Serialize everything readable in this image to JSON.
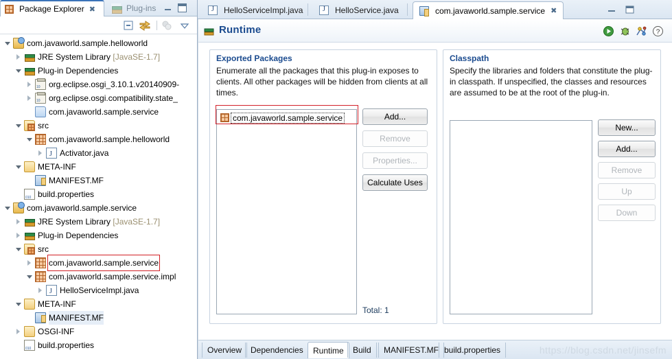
{
  "left_view": {
    "tabs": [
      {
        "label": "Package Explorer",
        "icon": "package-explorer-icon",
        "active": true,
        "closeable": true
      },
      {
        "label": "Plug-ins",
        "icon": "plugins-icon",
        "active": false,
        "closeable": false
      }
    ],
    "window_buttons": [
      "minimize-icon",
      "maximize-icon"
    ],
    "toolbar_icons": [
      "collapse-all-icon",
      "link-with-editor-icon",
      "focus-on-active-task-icon",
      "view-menu-icon"
    ],
    "tree": [
      {
        "label": "com.javaworld.sample.helloworld",
        "icon": "plugin-project-icon",
        "indent": 0,
        "twisty": "expanded"
      },
      {
        "label": "JRE System Library",
        "suffix": " [JavaSE-1.7]",
        "icon": "library-icon",
        "indent": 1,
        "twisty": "collapsed"
      },
      {
        "label": "Plug-in Dependencies",
        "icon": "library-icon",
        "indent": 1,
        "twisty": "expanded"
      },
      {
        "label": "org.eclipse.osgi_3.10.1.v20140909-",
        "icon": "jar-icon",
        "indent": 2,
        "twisty": "collapsed"
      },
      {
        "label": "org.eclipse.osgi.compatibility.state_",
        "icon": "jar-icon",
        "indent": 2,
        "twisty": "collapsed"
      },
      {
        "label": "com.javaworld.sample.service",
        "icon": "folder-blue-icon",
        "indent": 2,
        "twisty": "none"
      },
      {
        "label": "src",
        "icon": "source-folder-icon",
        "indent": 1,
        "twisty": "expanded"
      },
      {
        "label": "com.javaworld.sample.helloworld",
        "icon": "package-icon",
        "indent": 2,
        "twisty": "expanded"
      },
      {
        "label": "Activator.java",
        "icon": "java-file-icon",
        "indent": 3,
        "twisty": "collapsed"
      },
      {
        "label": "META-INF",
        "icon": "folder-icon",
        "indent": 1,
        "twisty": "expanded"
      },
      {
        "label": "MANIFEST.MF",
        "icon": "manifest-icon",
        "indent": 2,
        "twisty": "none"
      },
      {
        "label": "build.properties",
        "icon": "properties-file-icon",
        "indent": 1,
        "twisty": "none"
      },
      {
        "label": "com.javaworld.sample.service",
        "icon": "plugin-project-icon",
        "indent": 0,
        "twisty": "expanded"
      },
      {
        "label": "JRE System Library",
        "suffix": " [JavaSE-1.7]",
        "icon": "library-icon",
        "indent": 1,
        "twisty": "collapsed"
      },
      {
        "label": "Plug-in Dependencies",
        "icon": "library-icon",
        "indent": 1,
        "twisty": "collapsed"
      },
      {
        "label": "src",
        "icon": "source-folder-icon",
        "indent": 1,
        "twisty": "expanded"
      },
      {
        "label": "com.javaworld.sample.service",
        "icon": "package-icon",
        "indent": 2,
        "twisty": "collapsed",
        "highlight": "red-box"
      },
      {
        "label": "com.javaworld.sample.service.impl",
        "icon": "package-icon",
        "indent": 2,
        "twisty": "expanded"
      },
      {
        "label": "HelloServiceImpl.java",
        "icon": "java-file-icon",
        "indent": 3,
        "twisty": "collapsed"
      },
      {
        "label": "META-INF",
        "icon": "folder-icon",
        "indent": 1,
        "twisty": "expanded"
      },
      {
        "label": "MANIFEST.MF",
        "icon": "manifest-icon",
        "indent": 2,
        "twisty": "none",
        "highlight": "selected"
      },
      {
        "label": "OSGI-INF",
        "icon": "folder-icon",
        "indent": 1,
        "twisty": "collapsed"
      },
      {
        "label": "build.properties",
        "icon": "properties-file-icon",
        "indent": 1,
        "twisty": "none"
      }
    ]
  },
  "editor": {
    "tabs": [
      {
        "label": "HelloServiceImpl.java",
        "icon": "java-file-icon",
        "active": false,
        "closeable": false
      },
      {
        "label": "HelloService.java",
        "icon": "java-file-icon",
        "active": false,
        "closeable": false
      },
      {
        "label": "com.javaworld.sample.service",
        "icon": "manifest-icon",
        "active": true,
        "closeable": true
      }
    ],
    "window_buttons": [
      "minimize-icon",
      "maximize-icon"
    ],
    "form": {
      "title": "Runtime",
      "title_icon": "runtime-icon",
      "header_icons": [
        "run-icon",
        "debug-icon",
        "launch-validate-icon",
        "help-icon"
      ]
    },
    "exported_packages": {
      "title": "Exported Packages",
      "description": "Enumerate all the packages that this plug-in exposes to clients.  All other packages will be hidden from clients at all times.",
      "items": [
        {
          "label": "com.javaworld.sample.service",
          "icon": "package-icon",
          "focused": true
        }
      ],
      "buttons": [
        {
          "label": "Add...",
          "enabled": true
        },
        {
          "label": "Remove",
          "enabled": false
        },
        {
          "label": "Properties...",
          "enabled": false
        },
        {
          "label": "Calculate Uses",
          "enabled": true
        }
      ],
      "total_label": "Total: 1"
    },
    "classpath": {
      "title": "Classpath",
      "description": "Specify the libraries and folders that constitute the plug-in classpath.  If unspecified, the classes and resources are assumed to be at the root of the plug-in.",
      "items": [],
      "buttons": [
        {
          "label": "New...",
          "enabled": true
        },
        {
          "label": "Add...",
          "enabled": true
        },
        {
          "label": "Remove",
          "enabled": false
        },
        {
          "label": "Up",
          "enabled": false
        },
        {
          "label": "Down",
          "enabled": false
        }
      ]
    },
    "bottom_tabs": [
      {
        "label": "Overview",
        "active": false
      },
      {
        "label": "Dependencies",
        "active": false
      },
      {
        "label": "Runtime",
        "active": true
      },
      {
        "label": "Build",
        "active": false
      },
      {
        "label": "MANIFEST.MF",
        "active": false
      },
      {
        "label": "build.properties",
        "active": false
      }
    ]
  },
  "watermark": {
    "text": "https://blog.csdn.net/jinsefm"
  },
  "colors": {
    "accent_blue": "#1b4b8f",
    "highlight_red": "#d3202a",
    "tab_active_bg": "#ffffff",
    "panel_bg": "#f1f5fa"
  }
}
